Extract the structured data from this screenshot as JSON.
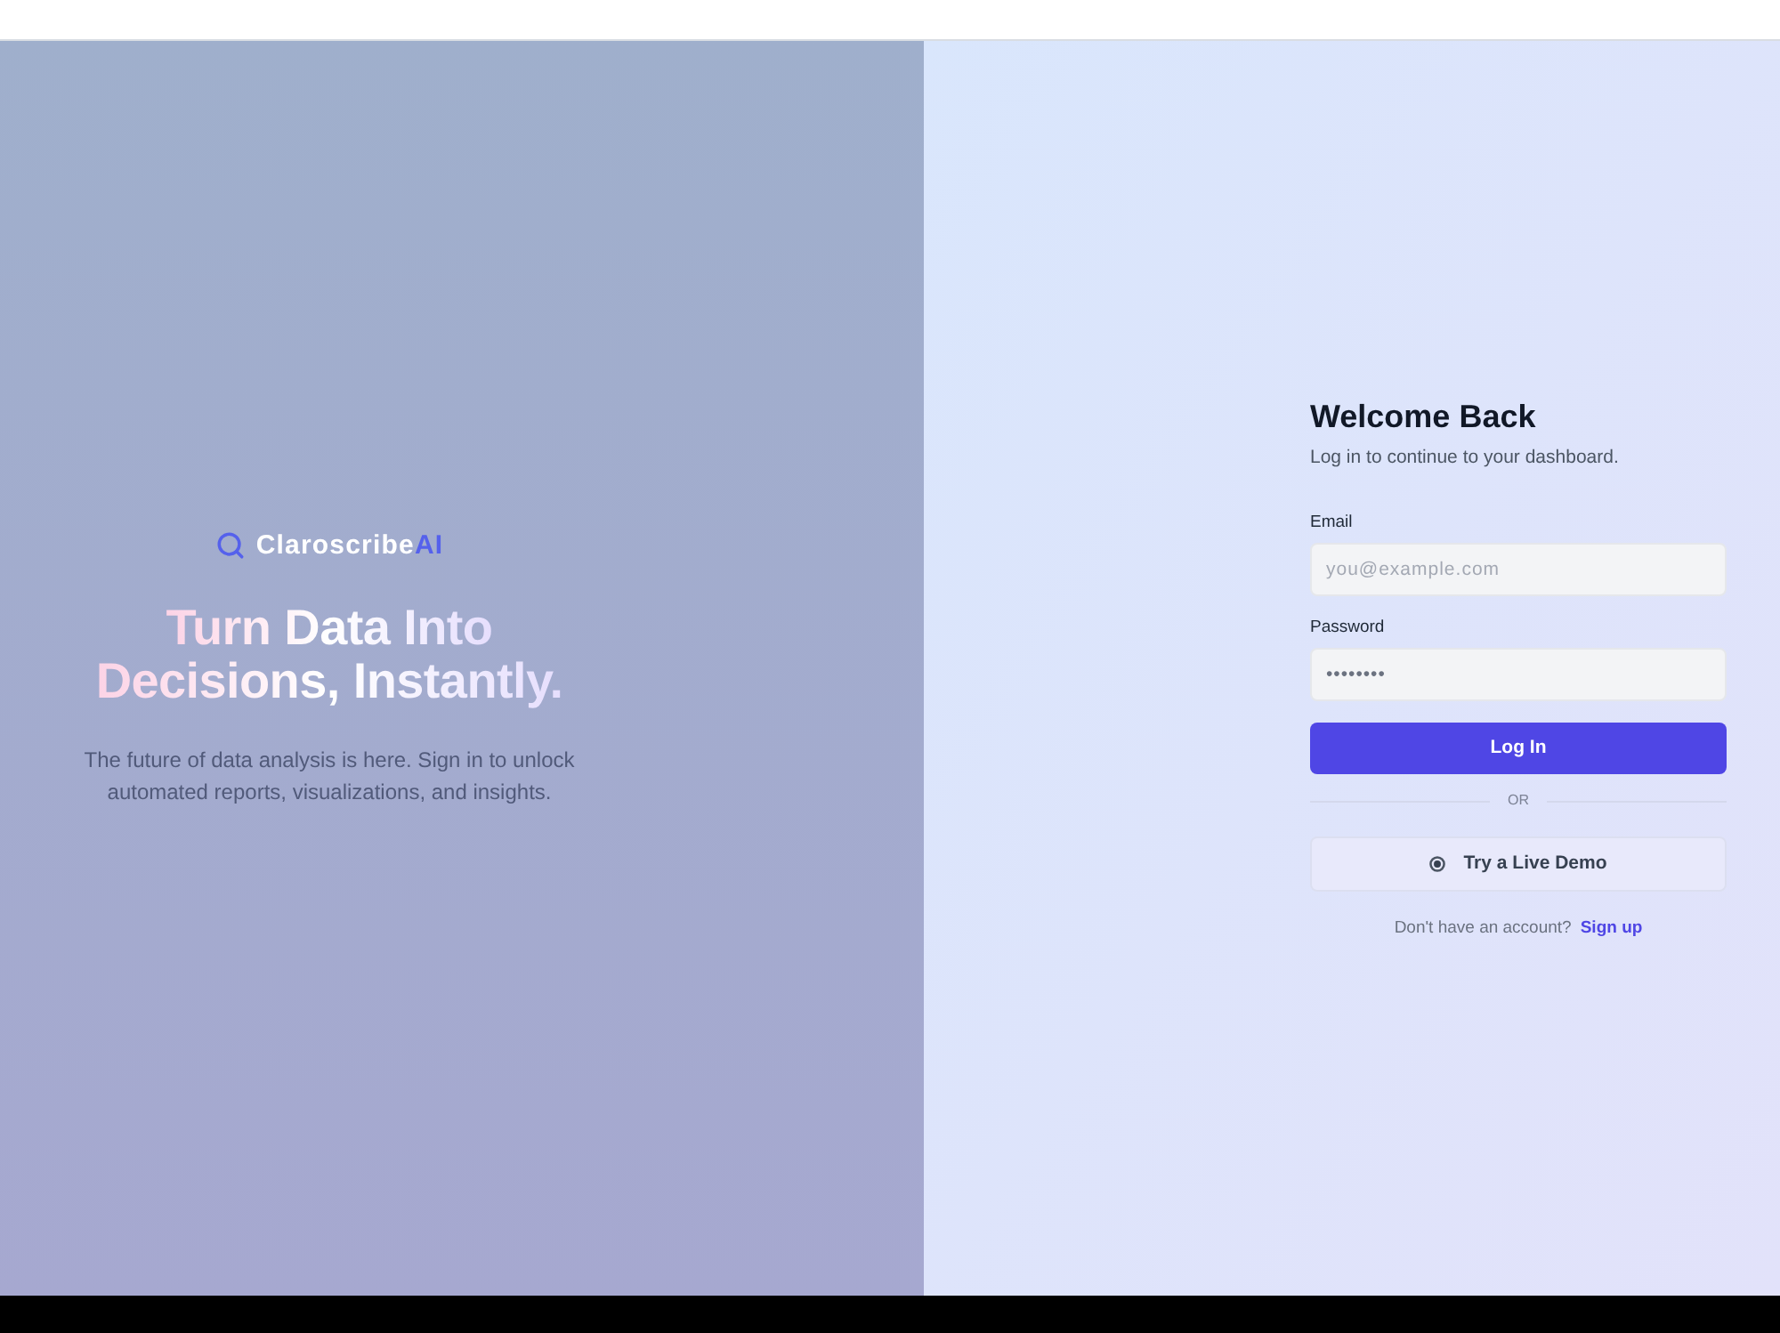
{
  "brand": {
    "name": "Claroscribe",
    "accent": "AI"
  },
  "hero": {
    "headline": [
      "Turn Data Into",
      "Decisions, Instantly."
    ],
    "subtitle": "The future of data analysis is here. Sign in to unlock automated reports, visualizations, and insights."
  },
  "login": {
    "title": "Welcome Back",
    "subtitle": "Log in to continue to your dashboard.",
    "fields": [
      {
        "label": "Email",
        "placeholder": "you@example.com"
      },
      {
        "label": "Password",
        "value": "••••••••"
      }
    ],
    "submit": "Log In",
    "divider": "OR",
    "demo_button": "Try a Live Demo",
    "signup": {
      "prompt": "Don't have an account?",
      "link": "Sign up"
    }
  }
}
